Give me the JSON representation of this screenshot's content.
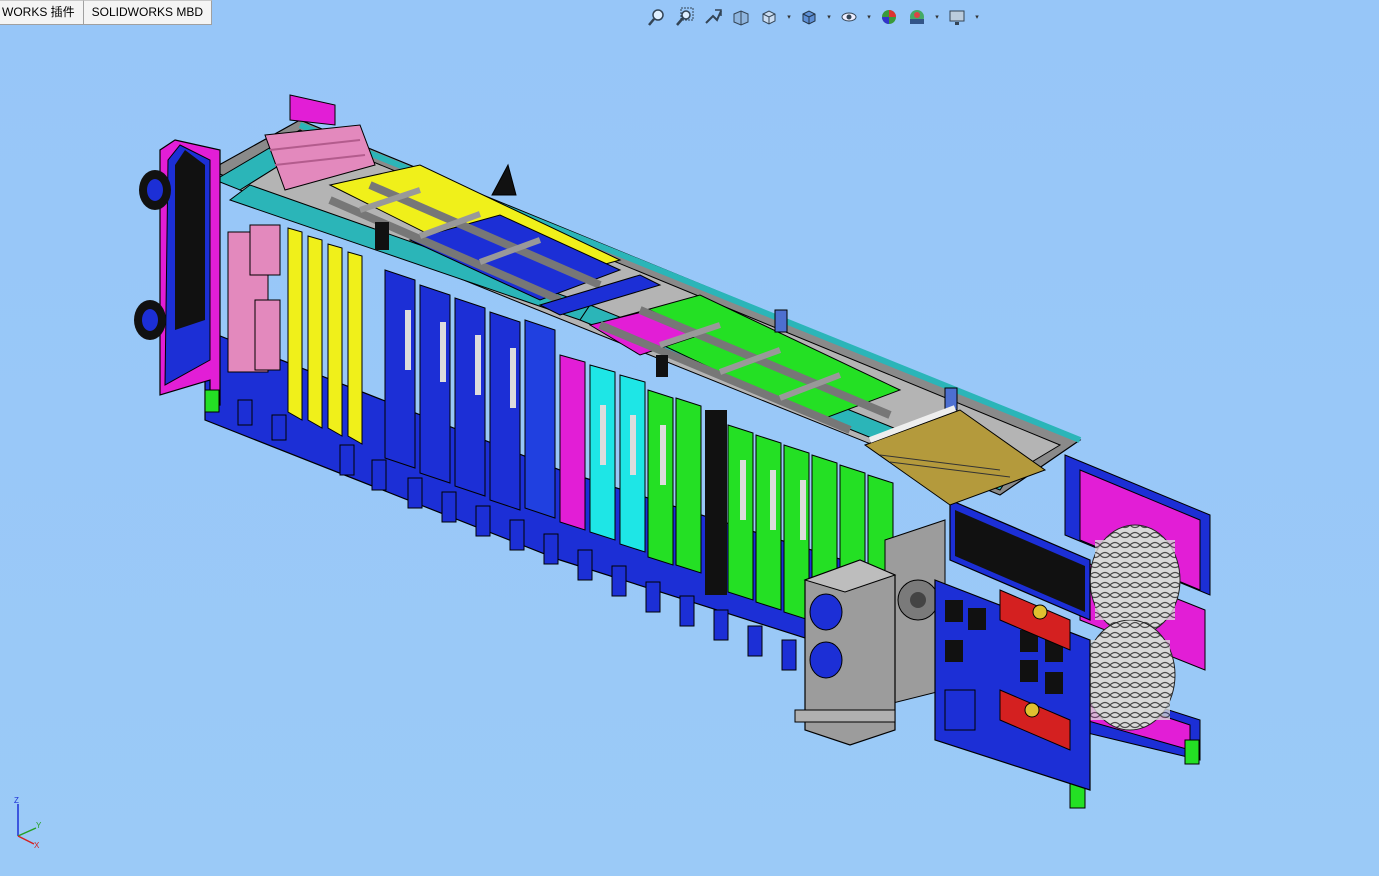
{
  "tabs": [
    {
      "label": "WORKS 插件"
    },
    {
      "label": "SOLIDWORKS MBD"
    }
  ],
  "hud_toolbar": [
    {
      "icon": "zoom-to-fit-icon",
      "dropdown": false
    },
    {
      "icon": "zoom-to-area-icon",
      "dropdown": false
    },
    {
      "icon": "previous-view-icon",
      "dropdown": false
    },
    {
      "icon": "section-view-icon",
      "dropdown": false
    },
    {
      "icon": "view-orientation-icon",
      "dropdown": true
    },
    {
      "icon": "display-style-icon",
      "dropdown": true
    },
    {
      "icon": "hide-show-items-icon",
      "dropdown": true
    },
    {
      "icon": "edit-appearance-icon",
      "dropdown": false
    },
    {
      "icon": "apply-scene-icon",
      "dropdown": true
    },
    {
      "icon": "view-settings-icon",
      "dropdown": true
    }
  ],
  "triad": {
    "x": "X",
    "y": "Y",
    "z": "Z"
  },
  "colors": {
    "background": "#97c6f8",
    "frame_blue": "#1c2fd6",
    "teal": "#2bb5b8",
    "magenta": "#e21ed6",
    "yellow": "#f0f01a",
    "green": "#24e024",
    "cyan": "#1ee6e6",
    "pink": "#e389bd",
    "gray": "#9c9c9c",
    "dark": "#111111"
  }
}
